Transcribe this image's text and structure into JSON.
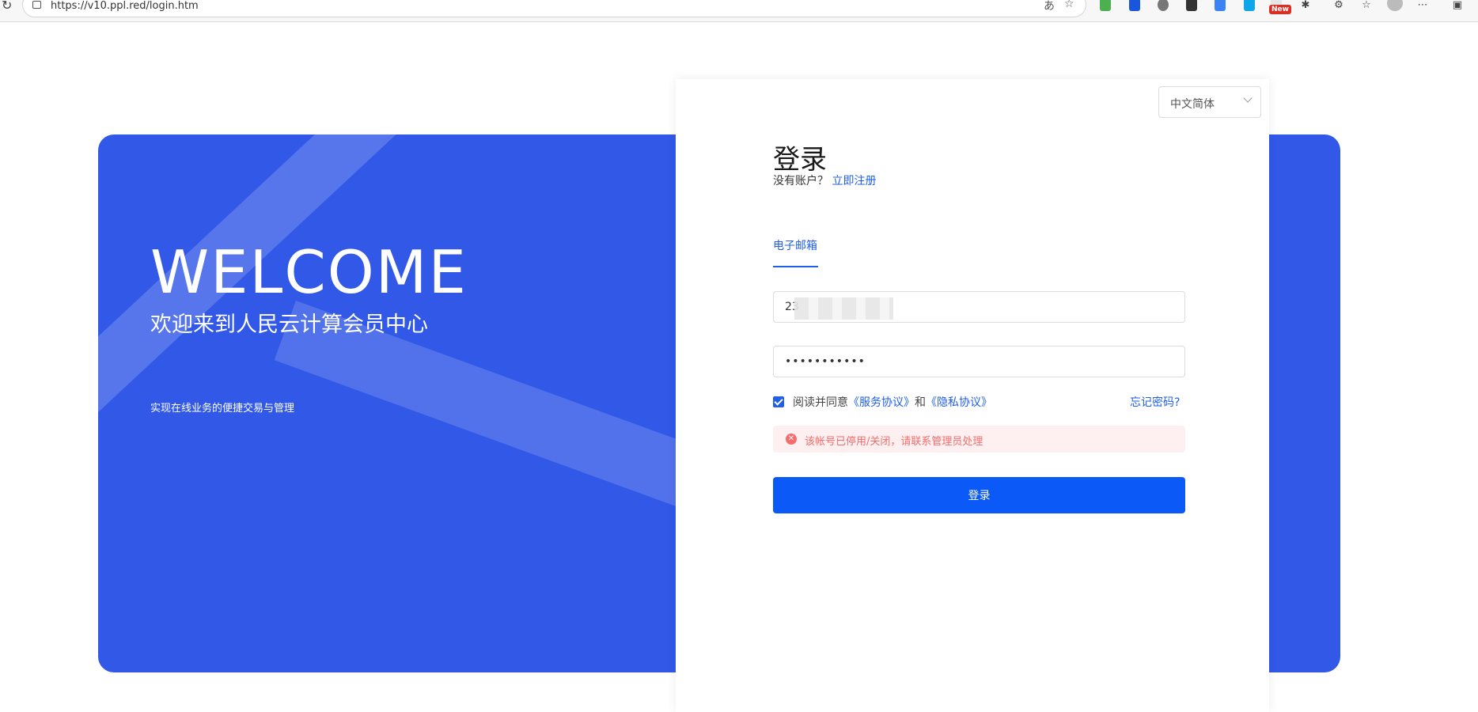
{
  "browser": {
    "url": "https://v10.ppl.red/login.htm",
    "new_badge": "New"
  },
  "banner": {
    "welcome": "WELCOME",
    "subtitle": "欢迎来到人民云计算会员中心",
    "slogan": "实现在线业务的便捷交易与管理"
  },
  "login": {
    "language": "中文简体",
    "title": "登录",
    "no_account": "没有账户？",
    "register_link": "立即注册",
    "tab_email": "电子邮箱",
    "email_value": "23",
    "password_value": "•••••••••••",
    "agree_prefix": "阅读并同意",
    "service_agreement": "《服务协议》",
    "and": "和",
    "privacy_agreement": "《隐私协议》",
    "forgot_password": "忘记密码?",
    "error_message": "该帐号已停用/关闭，请联系管理员处理",
    "submit": "登录"
  },
  "colors": {
    "banner_blue": "#3258e8",
    "link_blue": "#1f5fea",
    "button_blue": "#0b5af8",
    "error_red": "#f56c6c",
    "error_bg": "#fef0f0"
  }
}
